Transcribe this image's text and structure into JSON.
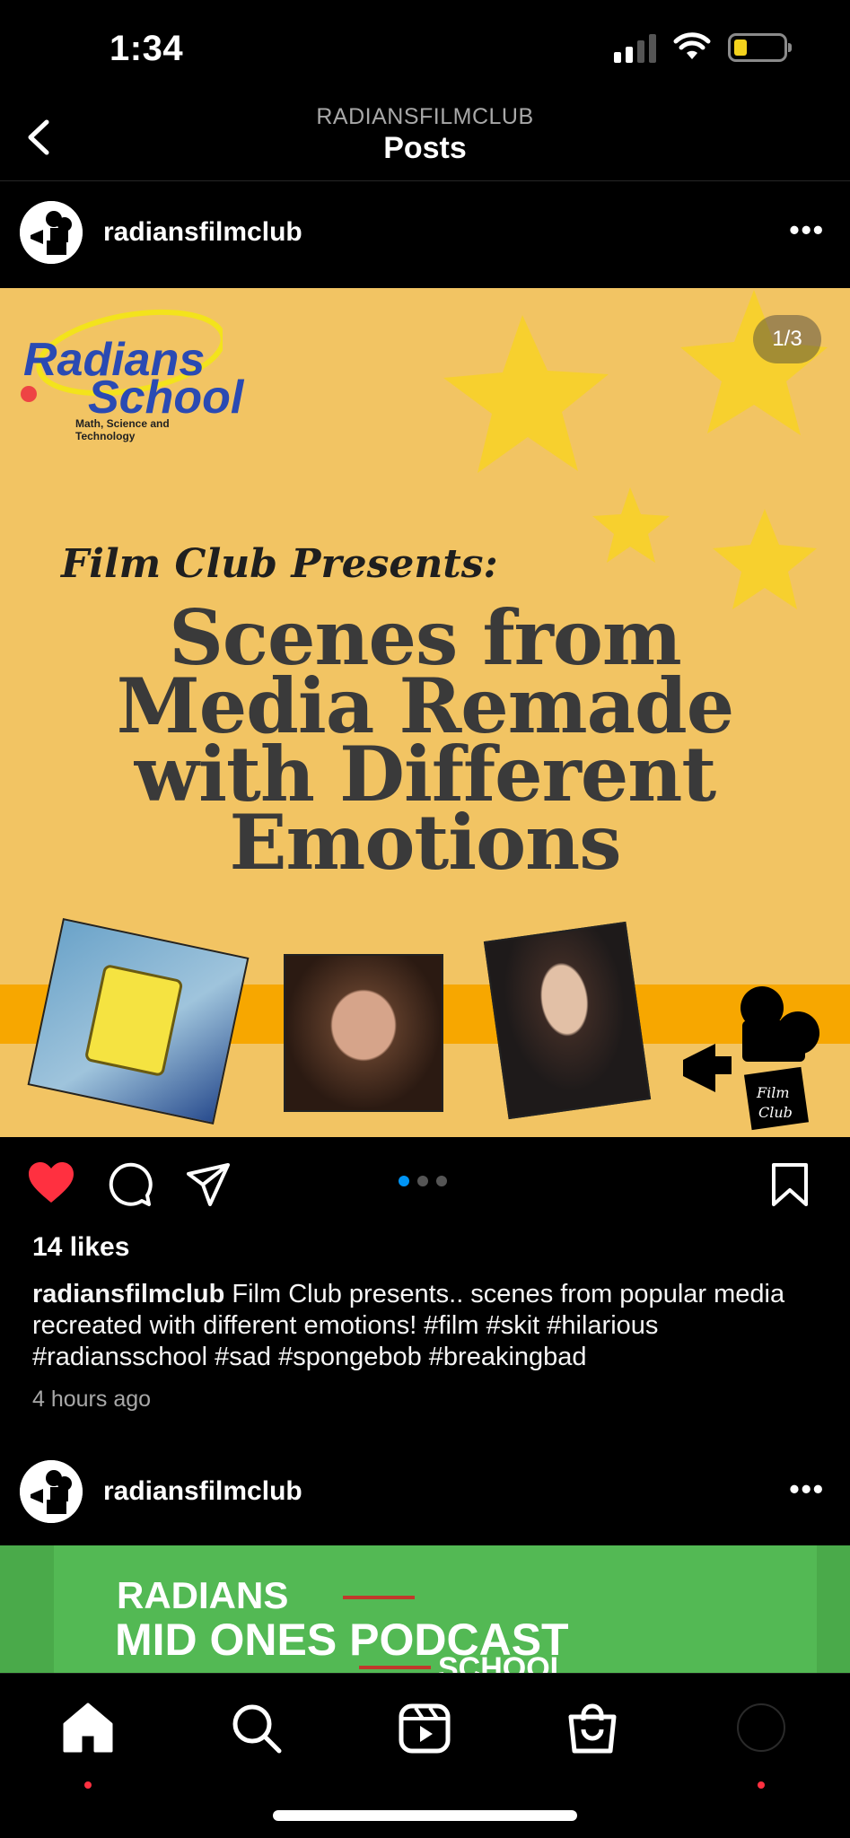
{
  "status_bar": {
    "time": "1:34",
    "battery_color": "#f3d21c"
  },
  "nav": {
    "account": "RADIANSFILMCLUB",
    "title": "Posts",
    "back_icon": "chevron-left-icon"
  },
  "post": {
    "username": "radiansfilmclub",
    "more_icon": "more-horizontal-icon",
    "image": {
      "counter": "1/3",
      "brand_name_line1": "Radians",
      "brand_name_line2": "School",
      "brand_tagline": "Math, Science and Technology",
      "presents": "Film Club Presents:",
      "title_lines": [
        "Scenes from",
        "Media Remade",
        "with Different",
        "Emotions"
      ],
      "club_logo_text_1": "Film",
      "club_logo_text_2": "Club"
    },
    "actions": {
      "like_icon": "heart-filled-icon",
      "comment_icon": "comment-icon",
      "share_icon": "send-icon",
      "save_icon": "bookmark-icon",
      "carousel_total": 3,
      "carousel_active": 1,
      "like_color": "#ff3040",
      "dot_active_color": "#0095f6"
    },
    "likes": "14 likes",
    "caption_user": "radiansfilmclub",
    "caption_text": "Film Club presents.. scenes from popular media recreated with different emotions! #film #skit #hilarious #radiansschool #sad #spongebob #breakingbad",
    "timestamp": "4 hours ago"
  },
  "next_post": {
    "username": "radiansfilmclub",
    "more_icon": "more-horizontal-icon",
    "preview_line1": "RADIANS",
    "preview_line2": "MID ONES PODCAST",
    "preview_line3": "SCHOOL"
  },
  "tabbar": {
    "items": [
      {
        "icon": "home-icon",
        "label": "Home",
        "active": true
      },
      {
        "icon": "search-icon",
        "label": "Search",
        "active": false
      },
      {
        "icon": "reels-icon",
        "label": "Reels",
        "active": false
      },
      {
        "icon": "shop-icon",
        "label": "Shop",
        "active": false
      },
      {
        "icon": "profile-avatar-icon",
        "label": "Profile",
        "active": false
      }
    ]
  }
}
